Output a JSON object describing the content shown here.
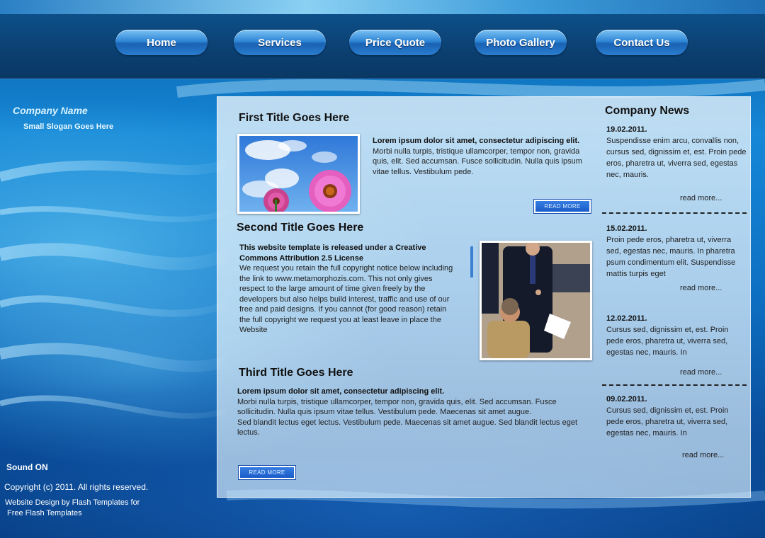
{
  "nav": {
    "items": [
      {
        "label": "Home"
      },
      {
        "label": "Services"
      },
      {
        "label": "Price Quote"
      },
      {
        "label": "Photo Gallery"
      },
      {
        "label": "Contact Us"
      }
    ]
  },
  "brand": {
    "company_name": "Company Name",
    "slogan": "Small Slogan Goes Here"
  },
  "footer": {
    "sound": "Sound ON",
    "copyright": "Copyright (c) 2011. All rights reserved.",
    "credit_line1": "Website Design by Flash Templates for",
    "credit_line2": "Free Flash Templates"
  },
  "articles": {
    "first": {
      "title": "First Title Goes Here",
      "lead": "Lorem ipsum dolor sit amet, consectetur adipiscing elit.",
      "body": "Morbi nulla turpis, tristique ullamcorper, tempor non, gravida quis, elit. Sed accumsan. Fusce sollicitudin. Nulla quis ipsum vitae tellus. Vestibulum pede.",
      "read_more": "READ MORE"
    },
    "second": {
      "title": "Second Title Goes Here",
      "lead": "This website template is released under a Creative Commons Attribution 2.5 License",
      "body": "We request you retain the full copyright notice below including the link to www.metamorphozis.com. This not only gives respect to the large amount of time given freely by the developers but also helps build interest, traffic and use of our free and paid designs. If you cannot (for good reason) retain the full copyright we request you at least leave in place the Website"
    },
    "third": {
      "title": "Third Title Goes Here",
      "lead": "Lorem ipsum dolor sit amet, consectetur adipiscing elit.",
      "body": "Morbi nulla turpis, tristique ullamcorper, tempor non, gravida quis, elit. Sed accumsan. Fusce sollicitudin. Nulla quis ipsum vitae tellus. Vestibulum pede. Maecenas sit amet augue.",
      "body2": "Sed blandit lectus eget lectus. Vestibulum pede. Maecenas sit amet augue. Sed blandit lectus eget lectus.",
      "read_more": "READ MORE"
    }
  },
  "news": {
    "title": "Company News",
    "items": [
      {
        "date": "19.02.2011.",
        "text": "Suspendisse enim arcu, convallis non, cursus sed, dignissim et, est. Proin pede eros, pharetra ut, viverra sed, egestas nec, mauris.",
        "more": "read more..."
      },
      {
        "date": "15.02.2011.",
        "text": "Proin pede eros, pharetra ut, viverra sed, egestas nec, mauris. In pharetra psum condimentum elit. Suspendisse mattis turpis eget",
        "more": "read more..."
      },
      {
        "date": "12.02.2011.",
        "text": "Cursus sed, dignissim et, est. Proin pede eros, pharetra ut, viverra sed, egestas nec, mauris. In",
        "more": "read more..."
      },
      {
        "date": "09.02.2011.",
        "text": "Cursus sed, dignissim et, est. Proin pede eros, pharetra ut, viverra sed, egestas nec, mauris. In",
        "more": "read more..."
      }
    ]
  },
  "colors": {
    "header_bg": "#0b3f70",
    "nav_button": "#2f86d6",
    "read_more_button": "#1556c4",
    "page_background": "#0e6fc2"
  },
  "icons": {
    "photo_flowers": "flowers-photo",
    "photo_business": "business-people-photo"
  }
}
